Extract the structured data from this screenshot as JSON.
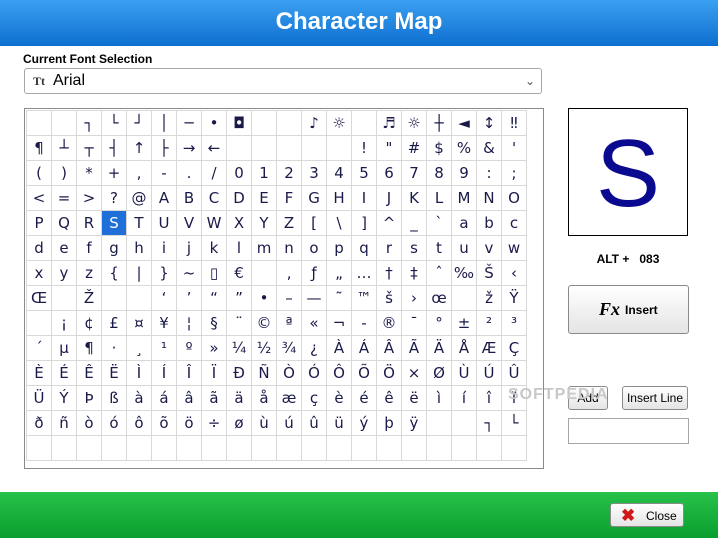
{
  "window": {
    "title": "Character Map"
  },
  "font": {
    "label": "Current Font Selection",
    "icon": "font-icon",
    "icon_glyph": "Tt",
    "selected": "Arial"
  },
  "grid": {
    "rows": [
      [
        "",
        "",
        "┐",
        "└",
        "┘",
        "│",
        "─",
        "•",
        "◘",
        "",
        "",
        "♪",
        "☼",
        "",
        "♬",
        "☼",
        "┼",
        "◄",
        "↕",
        "‼"
      ],
      [
        "¶",
        "┴",
        "┬",
        "┤",
        "↑",
        "├",
        "→",
        "←",
        "",
        "",
        "",
        "",
        "",
        "!",
        "\"",
        "#",
        "$",
        "%",
        "&",
        "'"
      ],
      [
        "(",
        ")",
        "*",
        "+",
        ",",
        "-",
        ".",
        "/",
        "0",
        "1",
        "2",
        "3",
        "4",
        "5",
        "6",
        "7",
        "8",
        "9",
        ":",
        ";"
      ],
      [
        "<",
        "=",
        ">",
        "?",
        "@",
        "A",
        "B",
        "C",
        "D",
        "E",
        "F",
        "G",
        "H",
        "I",
        "J",
        "K",
        "L",
        "M",
        "N",
        "O"
      ],
      [
        "P",
        "Q",
        "R",
        "S",
        "T",
        "U",
        "V",
        "W",
        "X",
        "Y",
        "Z",
        "[",
        "\\",
        "]",
        "^",
        "_",
        "`",
        "a",
        "b",
        "c"
      ],
      [
        "d",
        "e",
        "f",
        "g",
        "h",
        "i",
        "j",
        "k",
        "l",
        "m",
        "n",
        "o",
        "p",
        "q",
        "r",
        "s",
        "t",
        "u",
        "v",
        "w"
      ],
      [
        "x",
        "y",
        "z",
        "{",
        "|",
        "}",
        "~",
        "▯",
        "€",
        "",
        "‚",
        "ƒ",
        "„",
        "…",
        "†",
        "‡",
        "ˆ",
        "‰",
        "Š",
        "‹"
      ],
      [
        "Œ",
        "",
        "Ž",
        "",
        "",
        "‘",
        "’",
        "“",
        "”",
        "•",
        "–",
        "—",
        "˜",
        "™",
        "š",
        "›",
        "œ",
        "",
        "ž",
        "Ÿ"
      ],
      [
        "",
        "¡",
        "¢",
        "£",
        "¤",
        "¥",
        "¦",
        "§",
        "¨",
        "©",
        "ª",
        "«",
        "¬",
        "-",
        "®",
        "¯",
        "°",
        "±",
        "²",
        "³"
      ],
      [
        "´",
        "µ",
        "¶",
        "·",
        "¸",
        "¹",
        "º",
        "»",
        "¼",
        "½",
        "¾",
        "¿",
        "À",
        "Á",
        "Â",
        "Ã",
        "Ä",
        "Å",
        "Æ",
        "Ç"
      ],
      [
        "È",
        "É",
        "Ê",
        "Ë",
        "Ì",
        "Í",
        "Î",
        "Ï",
        "Ð",
        "Ñ",
        "Ò",
        "Ó",
        "Ô",
        "Õ",
        "Ö",
        "×",
        "Ø",
        "Ù",
        "Ú",
        "Û"
      ],
      [
        "Ü",
        "Ý",
        "Þ",
        "ß",
        "à",
        "á",
        "â",
        "ã",
        "ä",
        "å",
        "æ",
        "ç",
        "è",
        "é",
        "ê",
        "ë",
        "ì",
        "í",
        "î",
        "ï"
      ],
      [
        "ð",
        "ñ",
        "ò",
        "ó",
        "ô",
        "õ",
        "ö",
        "÷",
        "ø",
        "ù",
        "ú",
        "û",
        "ü",
        "ý",
        "þ",
        "ÿ",
        "",
        "",
        "┐",
        "└"
      ],
      [
        "",
        "",
        "",
        "",
        "",
        "",
        "",
        "",
        "",
        "",
        "",
        "",
        "",
        "",
        "",
        "",
        "",
        "",
        "",
        ""
      ]
    ],
    "selected": "S"
  },
  "preview": {
    "glyph": "S",
    "alt_label": "ALT +",
    "alt_code": "083"
  },
  "buttons": {
    "insert": "Insert",
    "insert_icon_glyph": "Fx",
    "add": "Add",
    "insert_line": "Insert Line",
    "close": "Close",
    "close_icon_glyph": "✖"
  },
  "watermark": "SOFTPEDIA",
  "colors": {
    "header": "#1a7fe0",
    "footer": "#17b03c",
    "selected_cell": "#1e6fd8",
    "glyph": "#0a0a90"
  }
}
